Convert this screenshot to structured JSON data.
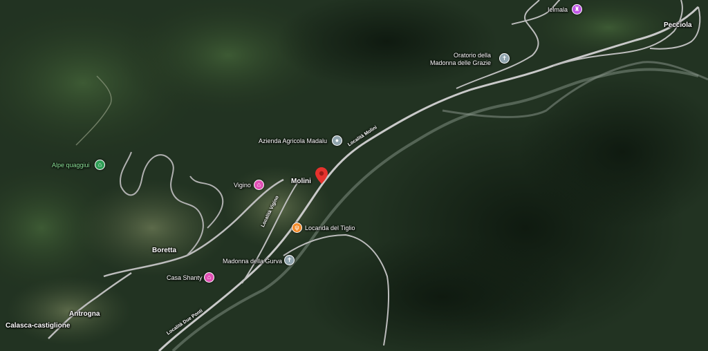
{
  "places": {
    "pecciola": "Pecciola",
    "ielmala": "Ielmala",
    "oratorio": "Oratorio della\nMadonna delle Grazie",
    "azienda": "Azienda Agricola Madalu",
    "alpe": "Alpe quaggiui",
    "molini": "Molini",
    "vigino": "Vigino",
    "locanda": "Locanda del Tiglio",
    "boretta": "Boretta",
    "madonna_gurva": "Madonna della Gurva",
    "casa_shanty": "Casa Shanty",
    "antrogna": "Antrogna",
    "calasca": "Calasca-castiglione"
  },
  "roads": {
    "molini": "Località Molini",
    "vigino": "Località Vigino",
    "due_ponti": "Località Due Ponti"
  },
  "colors": {
    "church": "#90a4ae",
    "attraction": "#c157e6",
    "shop": "#e04fb4",
    "food": "#f28b2c",
    "park": "#2f9e56",
    "info": "#90a4ae",
    "pin": "#e5322d"
  },
  "icons": {
    "church": "church-icon",
    "attraction": "attraction-icon",
    "shop": "shopping-icon",
    "food": "restaurant-icon",
    "park": "park-icon",
    "poi": "poi-icon",
    "pin": "location-pin-icon"
  }
}
